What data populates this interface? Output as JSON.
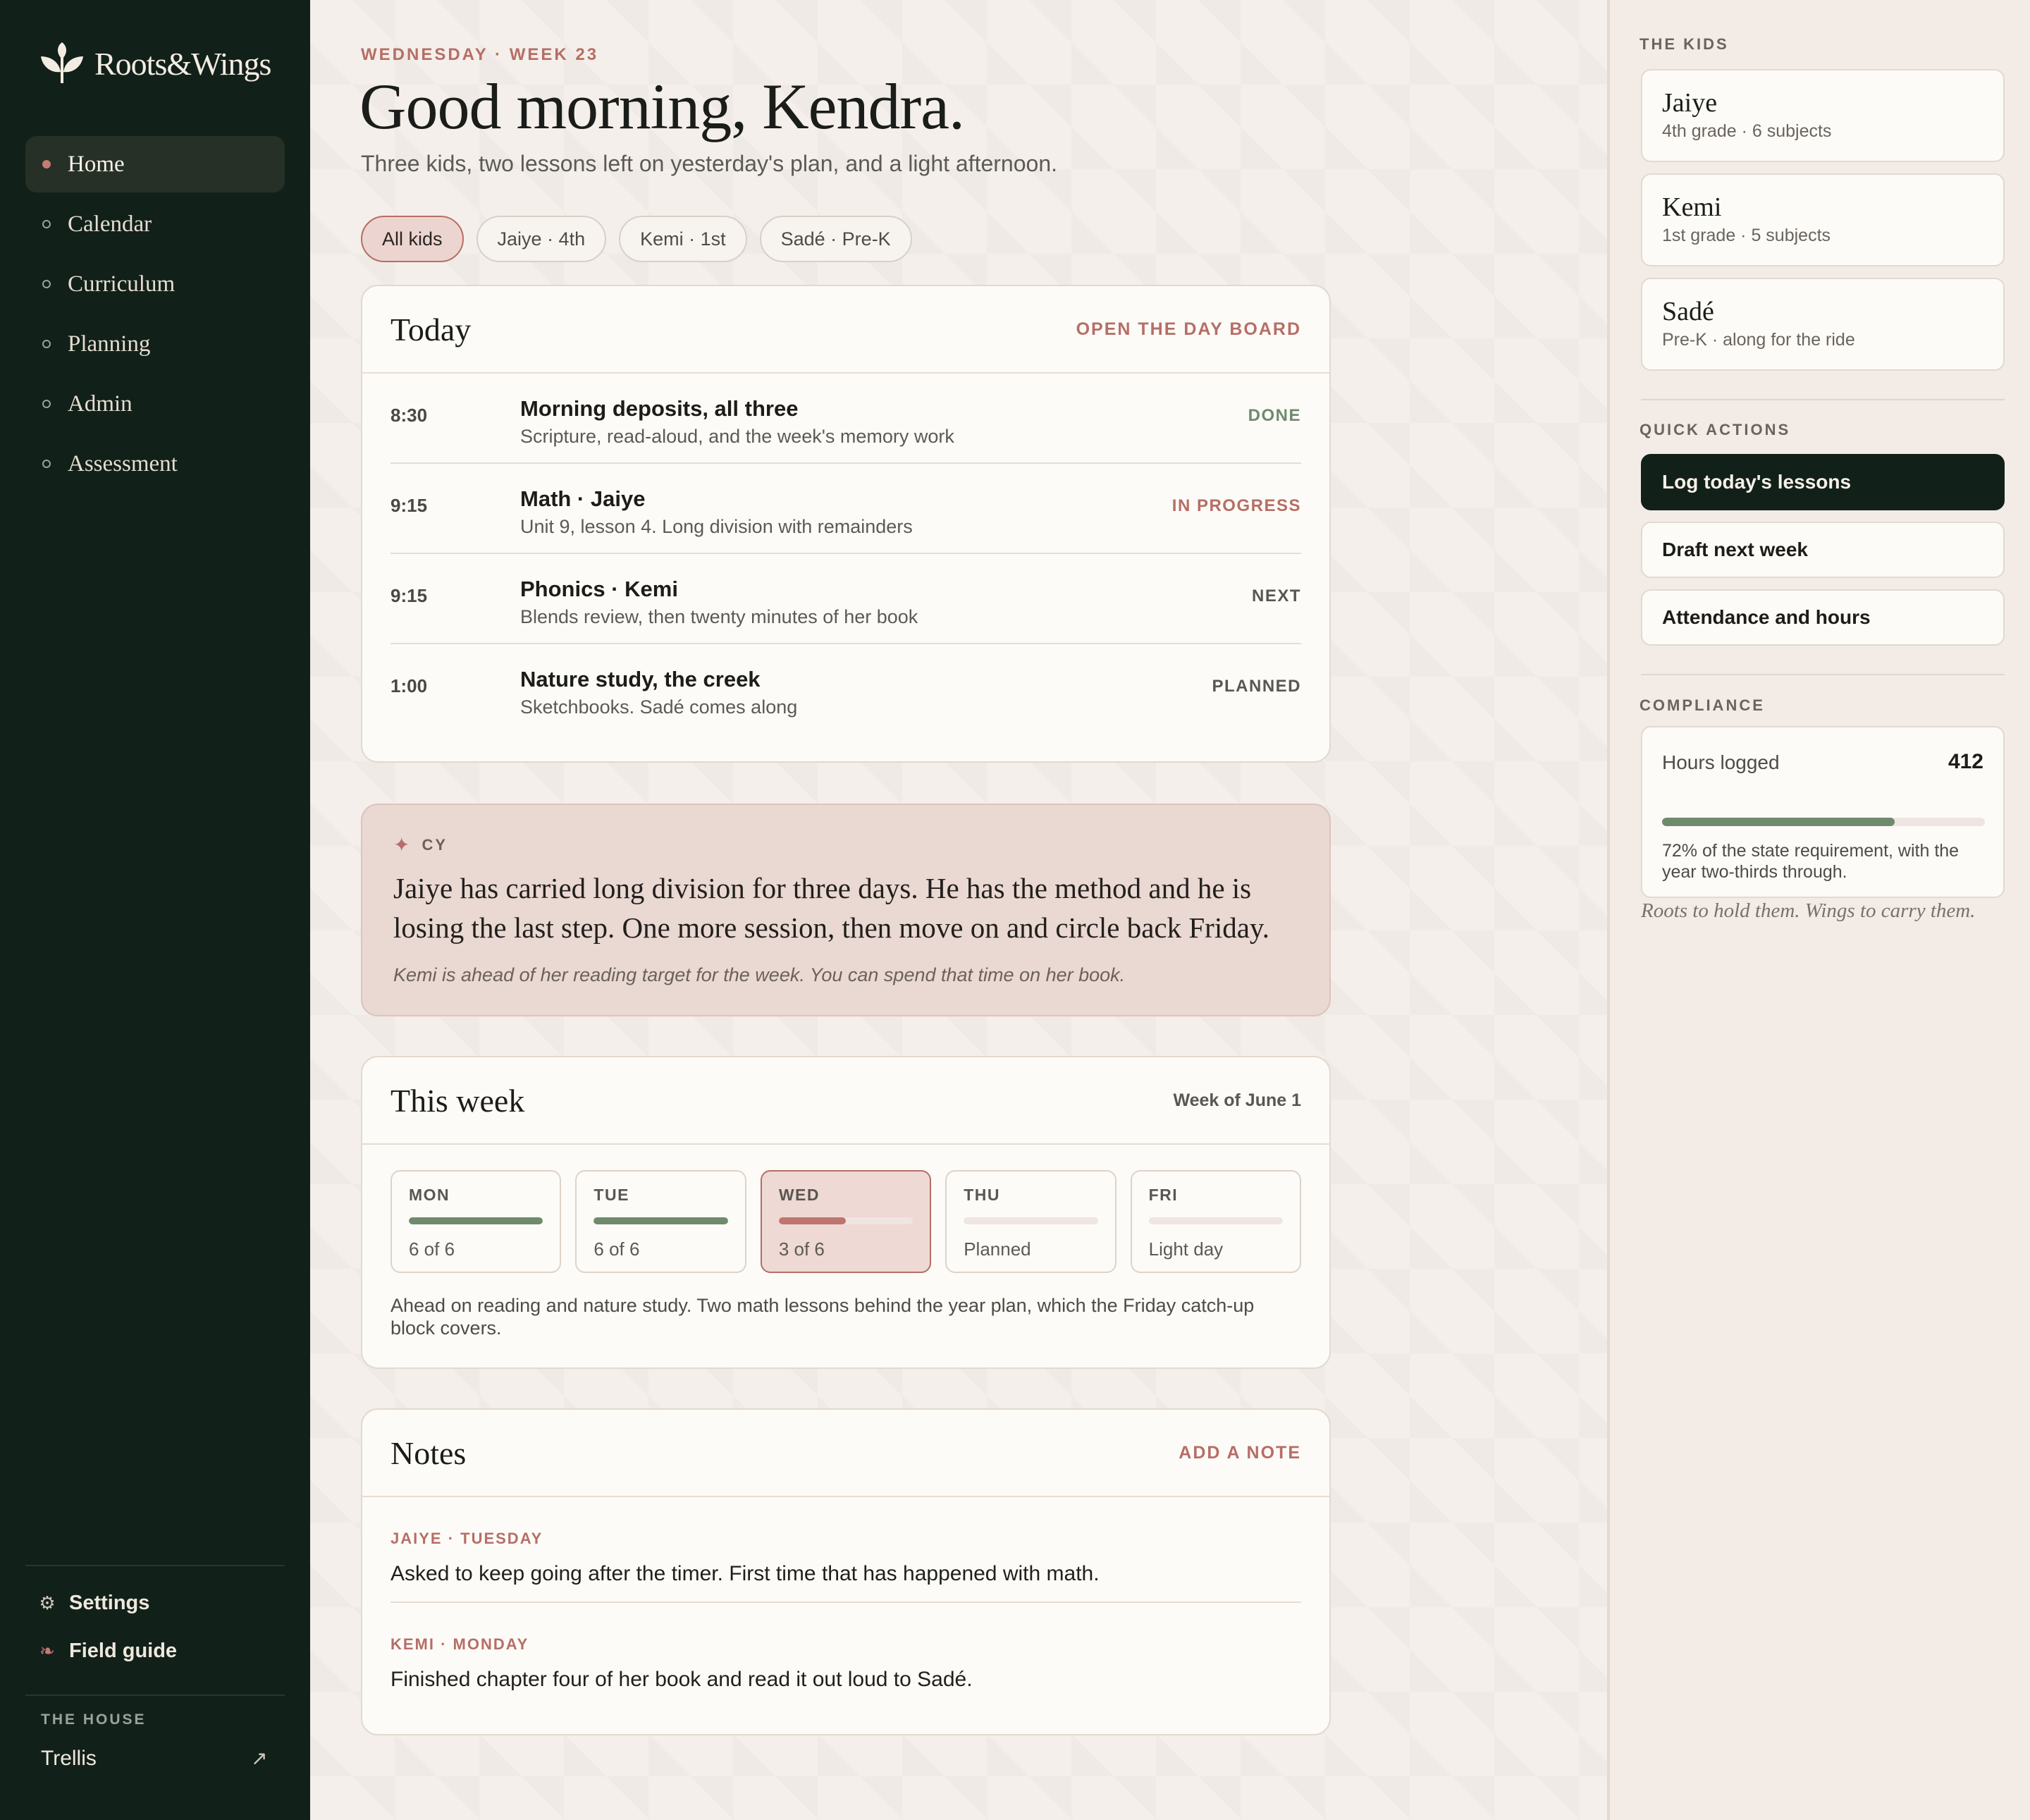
{
  "app": {
    "name": "Roots&Wings"
  },
  "sidebar": {
    "nav": [
      {
        "label": "Home",
        "active": true
      },
      {
        "label": "Calendar",
        "active": false
      },
      {
        "label": "Curriculum",
        "active": false
      },
      {
        "label": "Planning",
        "active": false
      },
      {
        "label": "Admin",
        "active": false
      },
      {
        "label": "Assessment",
        "active": false
      }
    ],
    "settings_label": "Settings",
    "field_guide_label": "Field guide",
    "house_label": "THE HOUSE",
    "house_name": "Trellis"
  },
  "header": {
    "eyebrow": "WEDNESDAY · WEEK 23",
    "greeting": "Good morning, Kendra.",
    "subline": "Three kids, two lessons left on yesterday's plan, and a light afternoon."
  },
  "filters": [
    {
      "label": "All kids",
      "active": true
    },
    {
      "label": "Jaiye · 4th",
      "active": false
    },
    {
      "label": "Kemi · 1st",
      "active": false
    },
    {
      "label": "Sadé · Pre-K",
      "active": false
    }
  ],
  "today": {
    "title": "Today",
    "action": "OPEN THE DAY BOARD",
    "items": [
      {
        "time": "8:30",
        "title": "Morning deposits, all three",
        "subtitle": "Scripture, read-aloud, and the week's memory work",
        "status": "DONE",
        "status_color": "#6f8a6d"
      },
      {
        "time": "9:15",
        "title": "Math · Jaiye",
        "subtitle": "Unit 9, lesson 4. Long division with remainders",
        "status": "IN PROGRESS",
        "status_color": "#b66e66"
      },
      {
        "time": "9:15",
        "title": "Phonics · Kemi",
        "subtitle": "Blends review, then twenty minutes of her book",
        "status": "NEXT",
        "status_color": "#5a5651"
      },
      {
        "time": "1:00",
        "title": "Nature study, the creek",
        "subtitle": "Sketchbooks. Sadé comes along",
        "status": "PLANNED",
        "status_color": "#5a5651"
      }
    ]
  },
  "insight": {
    "tag": "CY",
    "main": "Jaiye has carried long division for three days. He has the method and he is losing the last step. One more session, then move on and circle back Friday.",
    "note": "Kemi is ahead of her reading target for the week. You can spend that time on her book."
  },
  "week": {
    "title": "This week",
    "range": "Week of June 1",
    "days": [
      {
        "name": "MON",
        "sub": "6 of 6",
        "progress": 1.0,
        "color": "#6f8a6d",
        "current": false
      },
      {
        "name": "TUE",
        "sub": "6 of 6",
        "progress": 1.0,
        "color": "#6f8a6d",
        "current": false
      },
      {
        "name": "WED",
        "sub": "3 of 6",
        "progress": 0.5,
        "color": "#c07470",
        "current": true
      },
      {
        "name": "THU",
        "sub": "Planned",
        "progress": 0,
        "color": "#6f8a6d",
        "current": false
      },
      {
        "name": "FRI",
        "sub": "Light day",
        "progress": 0,
        "color": "#6f8a6d",
        "current": false
      }
    ],
    "summary": "Ahead on reading and nature study. Two math lessons behind the year plan, which the Friday catch-up block covers."
  },
  "notes": {
    "title": "Notes",
    "action": "ADD A NOTE",
    "items": [
      {
        "tag": "JAIYE · TUESDAY",
        "text": "Asked to keep going after the timer. First time that has happened with math."
      },
      {
        "tag": "KEMI · MONDAY",
        "text": "Finished chapter four of her book and read it out loud to Sadé."
      }
    ]
  },
  "right": {
    "kids_label": "THE KIDS",
    "kids": [
      {
        "name": "Jaiye",
        "sub": "4th grade · 6 subjects"
      },
      {
        "name": "Kemi",
        "sub": "1st grade · 5 subjects"
      },
      {
        "name": "Sadé",
        "sub": "Pre-K · along for the ride"
      }
    ],
    "quick_label": "QUICK ACTIONS",
    "quick": [
      {
        "label": "Log today's lessons",
        "primary": true
      },
      {
        "label": "Draft next week",
        "primary": false
      },
      {
        "label": "Attendance and hours",
        "primary": false
      }
    ],
    "compliance_label": "COMPLIANCE",
    "compliance": {
      "label": "Hours logged",
      "value": "412",
      "progress": 0.72,
      "note": "72% of the state requirement, with the year two-thirds through."
    },
    "motto": "Roots to hold them. Wings to carry them."
  },
  "colors": {
    "accent": "#b66e66",
    "dark": "#12201a",
    "sage": "#6f8a6d"
  }
}
